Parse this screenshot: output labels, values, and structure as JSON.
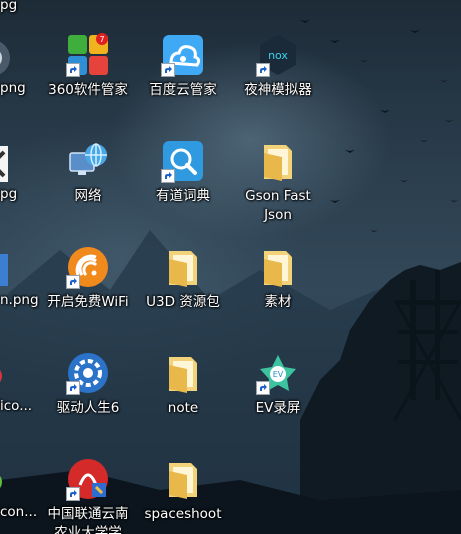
{
  "desktop": {
    "top_partial_label": "pg",
    "left_partial": [
      {
        "label": "png",
        "icon": "app-icon"
      },
      {
        "label": "pg",
        "icon": "app-icon"
      },
      {
        "label": "n.png",
        "icon": "app-icon"
      },
      {
        "label": "ico...",
        "icon": "app-icon"
      },
      {
        "label": "con...",
        "icon": "app-icon"
      }
    ],
    "icons": [
      {
        "label": "360软件管家",
        "icon": "360-software-manager-icon"
      },
      {
        "label": "百度云管家",
        "icon": "baidu-cloud-icon"
      },
      {
        "label": "夜神模拟器",
        "icon": "nox-emulator-icon"
      },
      {
        "label": "网络",
        "icon": "network-icon"
      },
      {
        "label": "有道词典",
        "icon": "youdao-dictionary-icon"
      },
      {
        "label": "Gson Fast\nJson",
        "icon": "folder-icon"
      },
      {
        "label": "开启免费WiFi",
        "icon": "free-wifi-icon"
      },
      {
        "label": "U3D 资源包",
        "icon": "folder-icon"
      },
      {
        "label": "素材",
        "icon": "folder-icon"
      },
      {
        "label": "驱动人生6",
        "icon": "driver-life-icon"
      },
      {
        "label": "note",
        "icon": "folder-icon"
      },
      {
        "label": "EV录屏",
        "icon": "ev-recorder-icon"
      },
      {
        "label": "中国联通云南\n农业大学学",
        "icon": "china-unicom-icon"
      },
      {
        "label": "spaceshoot",
        "icon": "folder-icon"
      }
    ],
    "badge_count": "7"
  }
}
